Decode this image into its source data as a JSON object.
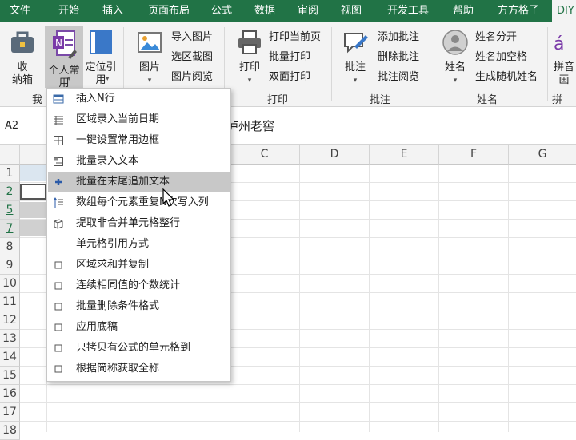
{
  "tabs": [
    "文件",
    "开始",
    "插入",
    "页面布局",
    "公式",
    "数据",
    "审阅",
    "视图",
    "开发工具",
    "帮助",
    "方方格子",
    "DIY工具箱"
  ],
  "active_tab": "DIY工具箱",
  "ribbon": {
    "btn_shou": "收\n纳箱",
    "btn_geren": "个人常\n用",
    "btn_dingwei": "定位引\n用",
    "btn_tupian": "图片",
    "tupian_items": [
      "导入图片",
      "选区截图",
      "图片阅览"
    ],
    "btn_dayin": "打印",
    "dayin_items": [
      "打印当前页",
      "批量打印",
      "双面打印"
    ],
    "btn_pizhu": "批注",
    "pizhu_items": [
      "添加批注",
      "删除批注",
      "批注阅览"
    ],
    "btn_xingming": "姓名",
    "xingming_items": [
      "姓名分开",
      "姓名加空格",
      "生成随机姓名"
    ],
    "btn_pinyin": "拼音\n画",
    "groups": {
      "wo": "我",
      "dayin": "打印",
      "pizhu": "批注",
      "xingming": "姓名",
      "pin": "拼"
    }
  },
  "formula_bar": {
    "namebox": "A2",
    "content": "泸州老窖"
  },
  "grid": {
    "col_headers": [
      "C",
      "D",
      "E",
      "F",
      "G"
    ],
    "row_headers": [
      "1",
      "2",
      "5",
      "7",
      "8",
      "9",
      "10",
      "11",
      "12",
      "13",
      "14",
      "15",
      "16",
      "17",
      "18"
    ]
  },
  "menu": {
    "items": [
      {
        "label": "插入N行",
        "icon": "table-row-icon"
      },
      {
        "label": "区域录入当前日期",
        "icon": "list-icon"
      },
      {
        "label": "一键设置常用边框",
        "icon": "border-icon"
      },
      {
        "label": "批量录入文本",
        "icon": "textbox-icon"
      },
      {
        "label": "批量在末尾追加文本",
        "icon": "plus-icon"
      },
      {
        "label": "数组每个元素重复N次写入列",
        "icon": "sort-icon"
      },
      {
        "label": "提取非合并单元格整行",
        "icon": "cube-icon"
      },
      {
        "label": "单元格引用方式",
        "icon": ""
      },
      {
        "label": "区域求和并复制",
        "icon": "checkbox-icon"
      },
      {
        "label": "连续相同值的个数统计",
        "icon": "checkbox-icon"
      },
      {
        "label": "批量删除条件格式",
        "icon": "checkbox-icon"
      },
      {
        "label": "应用底稿",
        "icon": "checkbox-icon"
      },
      {
        "label": "只拷贝有公式的单元格到",
        "icon": "checkbox-icon"
      },
      {
        "label": "根据简称获取全称",
        "icon": "checkbox-icon"
      }
    ],
    "hovered_index": 4
  }
}
